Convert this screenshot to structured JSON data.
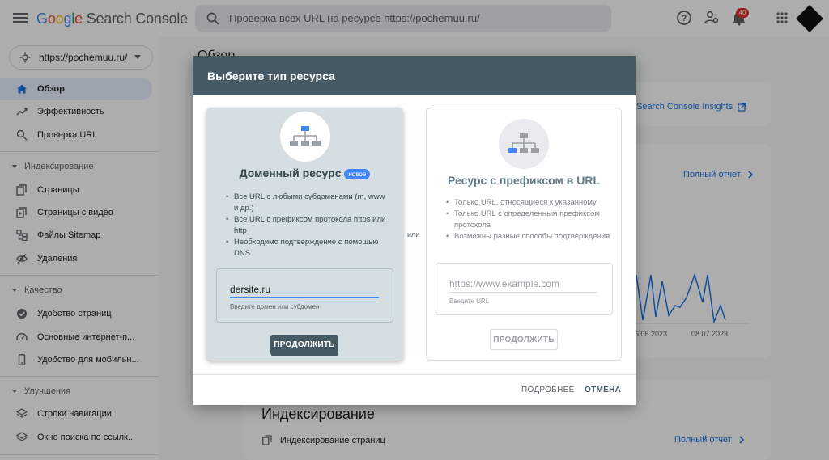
{
  "app": {
    "logo_google": [
      "G",
      "o",
      "o",
      "g",
      "l",
      "e"
    ],
    "logo_product": "Search Console",
    "search_placeholder": "Проверка всех URL на ресурсе https://pochemuu.ru/",
    "notifications_count": "40"
  },
  "sidebar": {
    "property": "https://pochemuu.ru/",
    "items": [
      {
        "label": "Обзор",
        "icon": "home-icon",
        "active": true
      },
      {
        "label": "Эффективность",
        "icon": "trending-up-icon"
      },
      {
        "label": "Проверка URL",
        "icon": "search-icon"
      }
    ],
    "sections": [
      {
        "label": "Индексирование",
        "items": [
          {
            "label": "Страницы",
            "icon": "pages-icon"
          },
          {
            "label": "Страницы с видео",
            "icon": "video-pages-icon"
          },
          {
            "label": "Файлы Sitemap",
            "icon": "sitemap-icon"
          },
          {
            "label": "Удаления",
            "icon": "removals-icon"
          }
        ]
      },
      {
        "label": "Качество",
        "items": [
          {
            "label": "Удобство страниц",
            "icon": "page-experience-icon"
          },
          {
            "label": "Основные интернет-п...",
            "icon": "web-vitals-icon"
          },
          {
            "label": "Удобство для мобильн...",
            "icon": "mobile-icon"
          }
        ]
      },
      {
        "label": "Улучшения",
        "items": [
          {
            "label": "Строки навигации",
            "icon": "breadcrumbs-icon"
          },
          {
            "label": "Окно поиска по ссылк...",
            "icon": "sitelinks-search-icon"
          }
        ]
      }
    ]
  },
  "main": {
    "title": "Обзор",
    "insights_link": "Search Console Insights",
    "full_report_1": "Полный отчет",
    "chart_dates": [
      "6.06.2023",
      "08.07.2023"
    ],
    "indexing_title": "Индексирование",
    "indexing_row": "Индексирование страниц",
    "full_report_2": "Полный отчет"
  },
  "dialog": {
    "title": "Выберите тип ресурса",
    "or": "или",
    "domain": {
      "title": "Доменный ресурс",
      "badge": "новое",
      "bullets": [
        "Все URL с любыми субдоменами (m, www и др.)",
        "Все URL с префиксом протокола https или http",
        "Необходимо подтверждение с помощью DNS"
      ],
      "input_value": "dersite.ru",
      "input_help": "Введите домен или субдомен",
      "button": "ПРОДОЛЖИТЬ"
    },
    "prefix": {
      "title": "Ресурс с префиксом в URL",
      "bullets": [
        "Только URL, относящиеся к указанному",
        "Только URL с определенным префиксом протокола",
        "Возможны разные способы подтверждения"
      ],
      "input_placeholder": "https://www.example.com",
      "input_help": "Введите URL",
      "button": "ПРОДОЛЖИТЬ"
    },
    "footer": {
      "more": "ПОДРОБНЕЕ",
      "cancel": "ОТМЕНА"
    }
  },
  "colors": {
    "header": "#455a64",
    "accent": "#4285f4",
    "link": "#1a73e8"
  }
}
